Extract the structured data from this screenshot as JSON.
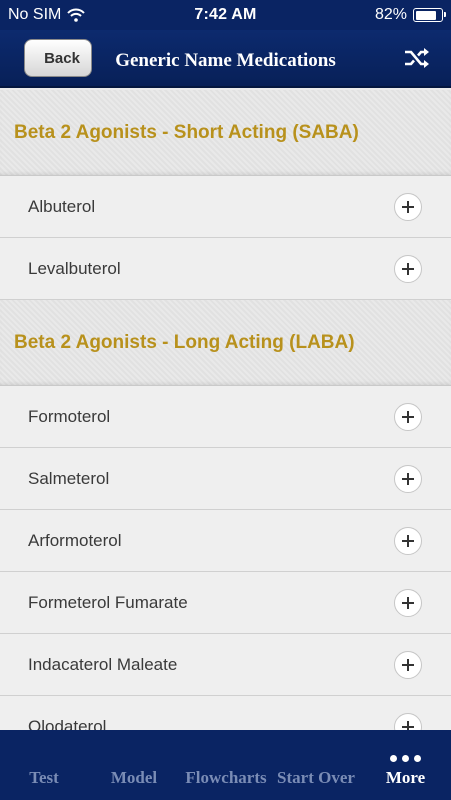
{
  "status_bar": {
    "carrier": "No SIM",
    "time": "7:42 AM",
    "battery_percent": "82%",
    "battery_level": 0.82
  },
  "nav": {
    "back_label": "Back",
    "title": "Generic Name Medications",
    "shuffle_icon": "shuffle-icon"
  },
  "sections": [
    {
      "title": "Beta 2 Agonists - Short Acting (SABA)",
      "items": [
        "Albuterol",
        "Levalbuterol"
      ]
    },
    {
      "title": "Beta 2 Agonists - Long Acting (LABA)",
      "items": [
        "Formoterol",
        "Salmeterol",
        "Arformoterol",
        "Formeterol Fumarate",
        "Indacaterol Maleate",
        "Olodaterol"
      ]
    }
  ],
  "tabs": [
    {
      "label": "Test",
      "active": false
    },
    {
      "label": "Model",
      "active": false
    },
    {
      "label": "Flowcharts",
      "active": false
    },
    {
      "label": "Start Over",
      "active": false
    },
    {
      "label": "More",
      "active": true,
      "icon": "more-dots-icon"
    }
  ],
  "colors": {
    "nav_bg": "#0a2463",
    "section_title": "#b8911c",
    "tab_inactive": "#7a8cb5",
    "tab_active": "#ffffff"
  }
}
